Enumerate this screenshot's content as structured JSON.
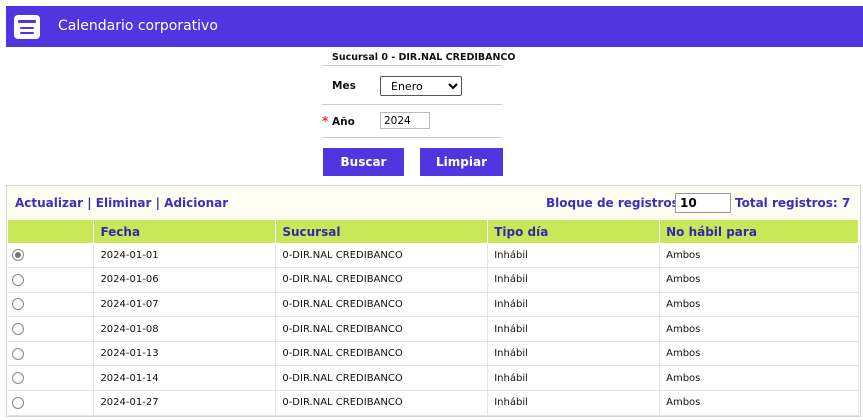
{
  "header": {
    "title": "Calendario corporativo",
    "icon": "calendar-list-icon"
  },
  "filter": {
    "sucursal": "Sucursal 0 - DIR.NAL CREDIBANCO",
    "mes_label": "Mes",
    "mes_value": "Enero",
    "anio_required_mark": "*",
    "anio_label": "Año",
    "anio_value": "2024"
  },
  "buttons": {
    "buscar": "Buscar",
    "limpiar": "Limpiar"
  },
  "toolbar": {
    "actualizar": "Actualizar",
    "eliminar": "Eliminar",
    "adicionar": "Adicionar",
    "separator": "|",
    "bloque_label": "Bloque de registros:",
    "bloque_value": "10",
    "total_label": "Total registros: 7"
  },
  "table": {
    "columns": [
      "",
      "Fecha",
      "Sucursal",
      "Tipo día",
      "No hábil para"
    ],
    "rows": [
      {
        "selected": true,
        "fecha": "2024-01-01",
        "sucursal": "0-DIR.NAL CREDIBANCO",
        "tipo": "Inhábil",
        "nohabil": "Ambos"
      },
      {
        "selected": false,
        "fecha": "2024-01-06",
        "sucursal": "0-DIR.NAL CREDIBANCO",
        "tipo": "Inhábil",
        "nohabil": "Ambos"
      },
      {
        "selected": false,
        "fecha": "2024-01-07",
        "sucursal": "0-DIR.NAL CREDIBANCO",
        "tipo": "Inhábil",
        "nohabil": "Ambos"
      },
      {
        "selected": false,
        "fecha": "2024-01-08",
        "sucursal": "0-DIR.NAL CREDIBANCO",
        "tipo": "Inhábil",
        "nohabil": "Ambos"
      },
      {
        "selected": false,
        "fecha": "2024-01-13",
        "sucursal": "0-DIR.NAL CREDIBANCO",
        "tipo": "Inhábil",
        "nohabil": "Ambos"
      },
      {
        "selected": false,
        "fecha": "2024-01-14",
        "sucursal": "0-DIR.NAL CREDIBANCO",
        "tipo": "Inhábil",
        "nohabil": "Ambos"
      },
      {
        "selected": false,
        "fecha": "2024-01-27",
        "sucursal": "0-DIR.NAL CREDIBANCO",
        "tipo": "Inhábil",
        "nohabil": "Ambos"
      }
    ]
  },
  "colors": {
    "brand": "#5035e0",
    "header_row": "#c8e85a",
    "link": "#3a2fc0"
  }
}
